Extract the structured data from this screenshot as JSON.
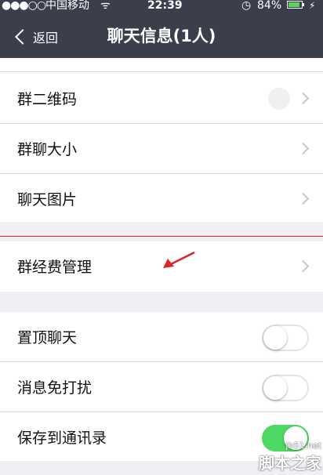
{
  "status_bar": {
    "signal": "●●●○○",
    "carrier": "中国移动",
    "wifi": "ᯤ",
    "time": "22:39",
    "alarm": "◷",
    "battery_percent": "84%",
    "charge": "⚡"
  },
  "header": {
    "back_label": "返回",
    "title": "聊天信息(1人)"
  },
  "group1": {
    "items": [
      {
        "label": "群二维码"
      },
      {
        "label": "群聊大小"
      },
      {
        "label": "聊天图片"
      }
    ]
  },
  "group2": {
    "items": [
      {
        "label": "群经费管理"
      }
    ]
  },
  "group3": {
    "items": [
      {
        "label": "置顶聊天",
        "toggle": "off"
      },
      {
        "label": "消息免打扰",
        "toggle": "off"
      },
      {
        "label": "保存到通讯录",
        "toggle": "on"
      }
    ]
  },
  "watermark": {
    "site": "jb51.net",
    "name": "脚本之家"
  },
  "colors": {
    "header_bg": "#3b3f4c",
    "toggle_on": "#4cd964",
    "annotation": "#e02424"
  }
}
